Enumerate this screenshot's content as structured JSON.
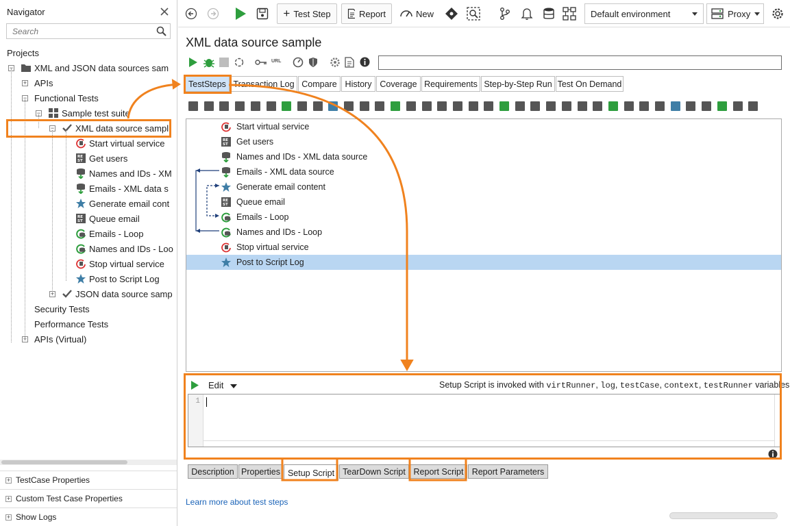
{
  "navigator": {
    "title": "Navigator",
    "search_placeholder": "Search",
    "projects_label": "Projects",
    "tree": [
      {
        "label": "XML and JSON data sources sam",
        "kind": "project"
      },
      {
        "label": "APIs",
        "kind": "folder"
      },
      {
        "label": "Functional Tests",
        "kind": "folder"
      },
      {
        "label": "Sample test suite",
        "kind": "suite"
      },
      {
        "label": "XML data source sampl",
        "kind": "testcase"
      },
      {
        "label": "Start virtual service",
        "kind": "virt-start"
      },
      {
        "label": "Get users",
        "kind": "rest"
      },
      {
        "label": "Names and IDs - XM",
        "kind": "datasource"
      },
      {
        "label": "Emails - XML data s",
        "kind": "datasource"
      },
      {
        "label": "Generate email cont",
        "kind": "groovy"
      },
      {
        "label": "Queue email",
        "kind": "rest"
      },
      {
        "label": "Emails - Loop",
        "kind": "loop"
      },
      {
        "label": "Names and IDs - Loo",
        "kind": "loop"
      },
      {
        "label": "Stop virtual service",
        "kind": "virt-stop"
      },
      {
        "label": "Post to Script Log",
        "kind": "groovy"
      },
      {
        "label": "JSON data source samp",
        "kind": "testcase"
      },
      {
        "label": "Security Tests",
        "kind": "folder"
      },
      {
        "label": "Performance Tests",
        "kind": "folder"
      },
      {
        "label": "APIs (Virtual)",
        "kind": "folder"
      }
    ],
    "bottom_panels": [
      "TestCase Properties",
      "Custom Test Case Properties"
    ],
    "show_logs": "Show Logs"
  },
  "toolbar": {
    "test_step": "Test Step",
    "report": "Report",
    "new": "New",
    "environment": "Default environment",
    "proxy": "Proxy"
  },
  "editor": {
    "title": "XML data source sample",
    "tabs": [
      "TestSteps",
      "Transaction Log",
      "Compare",
      "History",
      "Coverage",
      "Requirements",
      "Step-by-Step Run",
      "Test On Demand"
    ],
    "active_tab": "TestSteps",
    "steps": [
      {
        "label": "Start virtual service",
        "kind": "virt-start"
      },
      {
        "label": "Get users",
        "kind": "rest"
      },
      {
        "label": "Names and IDs - XML data source",
        "kind": "datasource"
      },
      {
        "label": "Emails - XML data source",
        "kind": "datasource"
      },
      {
        "label": "Generate email content",
        "kind": "groovy"
      },
      {
        "label": "Queue email",
        "kind": "rest"
      },
      {
        "label": "Emails - Loop",
        "kind": "loop"
      },
      {
        "label": "Names and IDs - Loop",
        "kind": "loop"
      },
      {
        "label": "Stop virtual service",
        "kind": "virt-stop"
      },
      {
        "label": "Post to Script Log",
        "kind": "groovy"
      }
    ],
    "selected_step": "Post to Script Log"
  },
  "script": {
    "edit_label": "Edit",
    "hint_prefix": "Setup Script is invoked with ",
    "vars": [
      "virtRunner",
      "log",
      "testCase",
      "context",
      "testRunner"
    ],
    "hint_suffix": " variables",
    "line_number": "1",
    "bottom_tabs": [
      "Description",
      "Properties",
      "Setup Script",
      "TearDown Script",
      "Report Script",
      "Report Parameters"
    ],
    "active_bottom_tab": "Setup Script",
    "learn_more": "Learn more about test steps"
  },
  "colors": {
    "highlight": "#f0821e",
    "selection": "#b9d6f2",
    "active_tab": "#cfe3f8",
    "run_green": "#2e9e3e",
    "link": "#1a63b8"
  }
}
